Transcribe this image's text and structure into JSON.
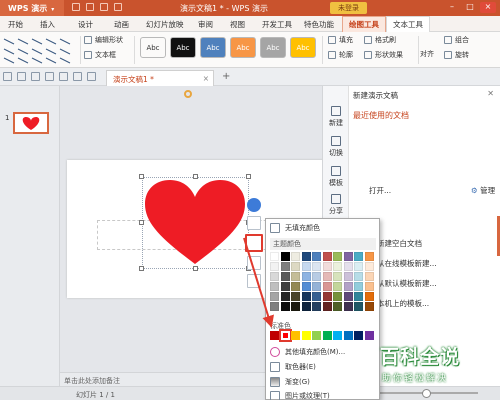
{
  "window": {
    "app_menu": "WPS 演示",
    "doc_title": "演示文稿1 * - WPS 演示",
    "login_button": "未登录"
  },
  "ribbon_tabs": [
    "开始",
    "插入",
    "设计",
    "动画",
    "幻灯片放映",
    "审阅",
    "视图",
    "开发工具",
    "特色功能",
    "绘图工具",
    "文本工具"
  ],
  "ribbon": {
    "edit_shape": "编辑形状",
    "text_box": "文本框",
    "style_boxes": [
      {
        "label": "Abc",
        "bg": "#ffffff",
        "fg": "#333333"
      },
      {
        "label": "Abc",
        "bg": "#111111",
        "fg": "#ffffff"
      },
      {
        "label": "Abc",
        "bg": "#4f81bd",
        "fg": "#ffffff"
      },
      {
        "label": "Abc",
        "bg": "#f79646",
        "fg": "#ffffff"
      },
      {
        "label": "Abc",
        "bg": "#a5a5a5",
        "fg": "#ffffff"
      },
      {
        "label": "Abc",
        "bg": "#ffc000",
        "fg": "#ffffff"
      }
    ],
    "fill": "填充",
    "format_painter": "格式刷",
    "outline": "轮廓",
    "shape_effects": "形状效果",
    "align": "对齐",
    "combine": "组合",
    "rotate": "旋转"
  },
  "doc_tab": {
    "label": "演示文稿1 *"
  },
  "thumbnails": {
    "slide_number": "1"
  },
  "slide": {
    "shape_color": "#ee1c25"
  },
  "notes_placeholder": "单击此处添加备注",
  "status": {
    "slide_count": "幻灯片 1 / 1"
  },
  "task_pane": {
    "header": "新建演示文稿",
    "side_tabs": [
      "新建",
      "切换",
      "模板",
      "分享"
    ],
    "recent_docs": "最近使用的文档",
    "open": "打开...",
    "manage": "管理",
    "new_section": "新建",
    "new_links": [
      "新建空白文档",
      "从在线模板新建...",
      "从默认模板新建...",
      "本机上的模板..."
    ]
  },
  "color_menu": {
    "no_fill": "无填充颜色",
    "theme_colors": "主题颜色",
    "standard_colors": "标准色",
    "more_colors": "其他填充颜色(M)...",
    "eyedropper": "取色器(E)",
    "gradient": "渐变(G)",
    "picture_texture": "图片或纹理(T)",
    "theme_grid": [
      [
        "#ffffff",
        "#000000",
        "#eeece1",
        "#1f497d",
        "#4f81bd",
        "#c0504d",
        "#9bbb59",
        "#8064a2",
        "#4bacc6",
        "#f79646"
      ],
      [
        "#f2f2f2",
        "#7f7f7f",
        "#ddd9c3",
        "#c6d9f0",
        "#dbe5f1",
        "#f2dcdb",
        "#ebf1dd",
        "#e5e0ec",
        "#dbeef3",
        "#fdeada"
      ],
      [
        "#d8d8d8",
        "#595959",
        "#c4bd97",
        "#8db3e2",
        "#b8cce4",
        "#e5b9b7",
        "#d7e3bc",
        "#ccc1d9",
        "#b7dde8",
        "#fbd5b5"
      ],
      [
        "#bfbfbf",
        "#3f3f3f",
        "#938953",
        "#548dd4",
        "#95b3d7",
        "#d99694",
        "#c3d69b",
        "#b2a2c7",
        "#92cddc",
        "#fac08f"
      ],
      [
        "#a5a5a5",
        "#262626",
        "#494429",
        "#17365d",
        "#366092",
        "#953734",
        "#76923c",
        "#5f497a",
        "#31859b",
        "#e36c09"
      ],
      [
        "#7f7f7f",
        "#0c0c0c",
        "#1d1b10",
        "#0f243e",
        "#244061",
        "#632423",
        "#4f6128",
        "#3f3151",
        "#205867",
        "#974806"
      ]
    ],
    "standard_grid": [
      "#c00000",
      "#ff0000",
      "#ffc000",
      "#ffff00",
      "#92d050",
      "#00b050",
      "#00b0f0",
      "#0070c0",
      "#002060",
      "#7030a0"
    ],
    "selected_standard_index": 1
  },
  "watermark": {
    "title": "百科全说",
    "subtitle": "助你轻松解决"
  }
}
